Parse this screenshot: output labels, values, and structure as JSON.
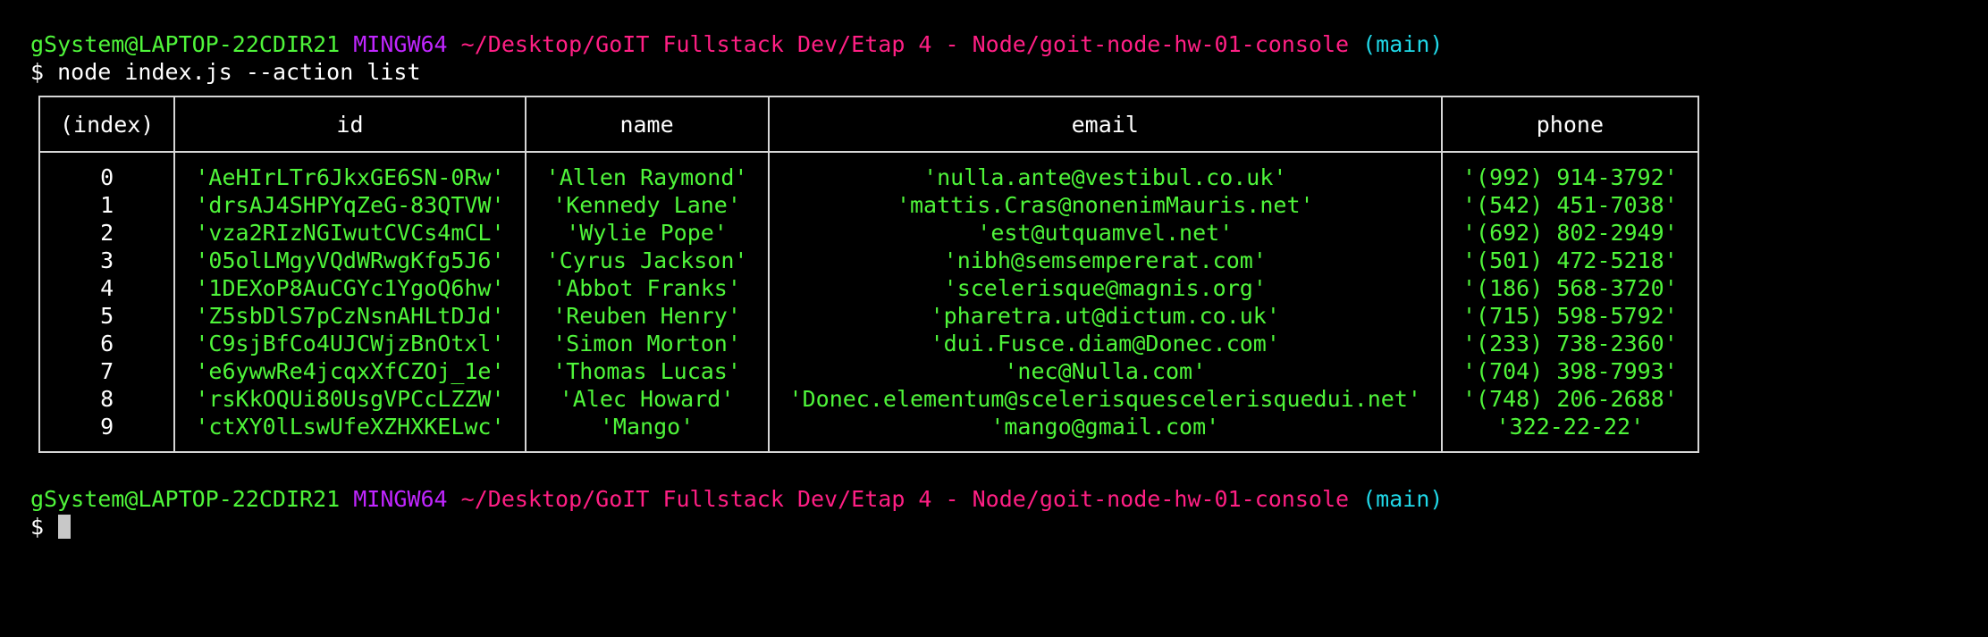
{
  "prompt": {
    "user_host": "gSystem@LAPTOP-22CDIR21",
    "msystem": "MINGW64",
    "path": "~/Desktop/GoIT Fullstack Dev/Etap 4 - Node/goit-node-hw-01-console",
    "branch": "(main)",
    "dollar": "$"
  },
  "command": "node index.js --action list",
  "table": {
    "columns": [
      "(index)",
      "id",
      "name",
      "email",
      "phone"
    ],
    "rows": [
      {
        "index": "0",
        "id": "'AeHIrLTr6JkxGE6SN-0Rw'",
        "name": "'Allen Raymond'",
        "email": "'nulla.ante@vestibul.co.uk'",
        "phone": "'(992) 914-3792'"
      },
      {
        "index": "1",
        "id": "'drsAJ4SHPYqZeG-83QTVW'",
        "name": "'Kennedy Lane'",
        "email": "'mattis.Cras@nonenimMauris.net'",
        "phone": "'(542) 451-7038'"
      },
      {
        "index": "2",
        "id": "'vza2RIzNGIwutCVCs4mCL'",
        "name": "'Wylie Pope'",
        "email": "'est@utquamvel.net'",
        "phone": "'(692) 802-2949'"
      },
      {
        "index": "3",
        "id": "'05olLMgyVQdWRwgKfg5J6'",
        "name": "'Cyrus Jackson'",
        "email": "'nibh@semsempererat.com'",
        "phone": "'(501) 472-5218'"
      },
      {
        "index": "4",
        "id": "'1DEXoP8AuCGYc1YgoQ6hw'",
        "name": "'Abbot Franks'",
        "email": "'scelerisque@magnis.org'",
        "phone": "'(186) 568-3720'"
      },
      {
        "index": "5",
        "id": "'Z5sbDlS7pCzNsnAHLtDJd'",
        "name": "'Reuben Henry'",
        "email": "'pharetra.ut@dictum.co.uk'",
        "phone": "'(715) 598-5792'"
      },
      {
        "index": "6",
        "id": "'C9sjBfCo4UJCWjzBnOtxl'",
        "name": "'Simon Morton'",
        "email": "'dui.Fusce.diam@Donec.com'",
        "phone": "'(233) 738-2360'"
      },
      {
        "index": "7",
        "id": "'e6ywwRe4jcqxXfCZOj_1e'",
        "name": "'Thomas Lucas'",
        "email": "'nec@Nulla.com'",
        "phone": "'(704) 398-7993'"
      },
      {
        "index": "8",
        "id": "'rsKkOQUi80UsgVPCcLZZW'",
        "name": "'Alec Howard'",
        "email": "'Donec.elementum@scelerisquescelerisquedui.net'",
        "phone": "'(748) 206-2688'"
      },
      {
        "index": "9",
        "id": "'ctXY0lLswUfeXZHXKELwc'",
        "name": "'Mango'",
        "email": "'mango@gmail.com'",
        "phone": "'322-22-22'"
      }
    ]
  },
  "colors": {
    "background": "#000000",
    "user_host": "#4ff53a",
    "msystem": "#c026ff",
    "path": "#ff1f84",
    "branch": "#20d8e8",
    "values": "#4ff53a",
    "border": "#d6d6d6",
    "cursor": "#c8c8c8"
  }
}
